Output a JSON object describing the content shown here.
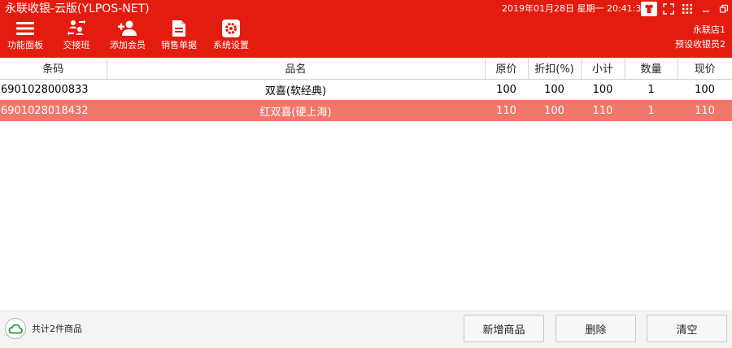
{
  "header": {
    "title": "永联收银-云版(YLPOS-NET)",
    "datetime": "2019年01月28日 星期一 20:41:35",
    "store": "永联店1",
    "cashier": "预设收银员2",
    "toolbar": [
      {
        "label": "功能面板",
        "icon": "menu-icon"
      },
      {
        "label": "交接班",
        "icon": "shift-exchange-icon"
      },
      {
        "label": "添加会员",
        "icon": "add-member-icon"
      },
      {
        "label": "销售单据",
        "icon": "document-icon"
      },
      {
        "label": "系统设置",
        "icon": "settings-icon"
      }
    ]
  },
  "table": {
    "columns": [
      "条码",
      "品名",
      "原价",
      "折扣(%)",
      "小计",
      "数量",
      "现价"
    ],
    "rows": [
      {
        "barcode": "6901028000833",
        "name": "双喜(软经典)",
        "price": "100",
        "discount": "100",
        "subtotal": "100",
        "qty": "1",
        "current": "100"
      },
      {
        "barcode": "6901028018432",
        "name": "红双喜(硬上海)",
        "price": "110",
        "discount": "100",
        "subtotal": "110",
        "qty": "1",
        "current": "110"
      }
    ]
  },
  "footer": {
    "count": "共计2件商品",
    "add_label": "新增商品",
    "delete_label": "删除",
    "clear_label": "清空"
  },
  "colors": {
    "header_bg": "#e41b0f",
    "selected_row": "#f0776b",
    "cloud_icon": "#2e9a3e"
  }
}
